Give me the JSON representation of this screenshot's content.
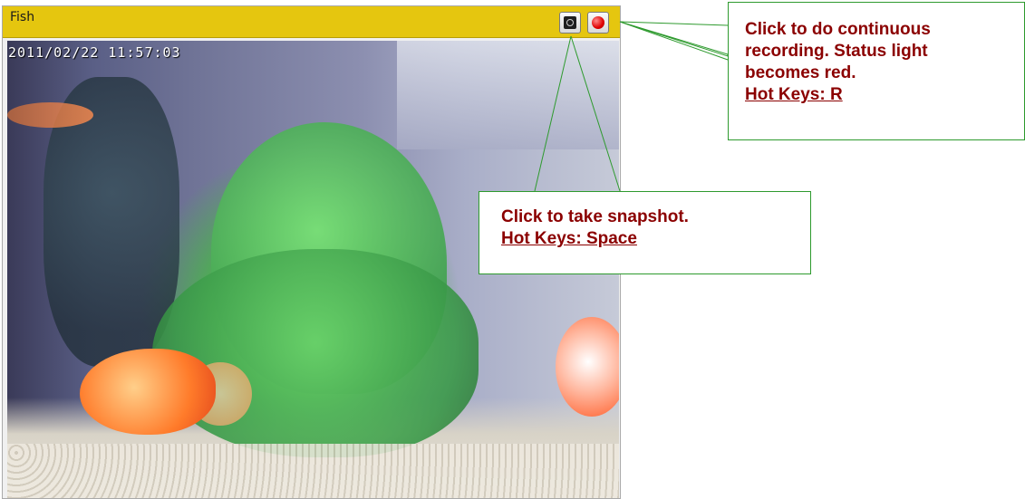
{
  "camera": {
    "title": "Fish",
    "timestamp": "2011/02/22 11:57:03",
    "snapshot_icon": "camera-icon",
    "record_icon": "record-dot-icon",
    "record_color": "#e00000"
  },
  "callouts": {
    "record": {
      "lines": [
        "Click to do continuous",
        "recording. Status light",
        "becomes red."
      ],
      "hotkeys": "Hot Keys: R"
    },
    "snapshot": {
      "lines": [
        "Click to take snapshot."
      ],
      "hotkeys": "Hot Keys: Space"
    },
    "text_color": "#8b0000",
    "border_color": "#2e9a2e"
  }
}
